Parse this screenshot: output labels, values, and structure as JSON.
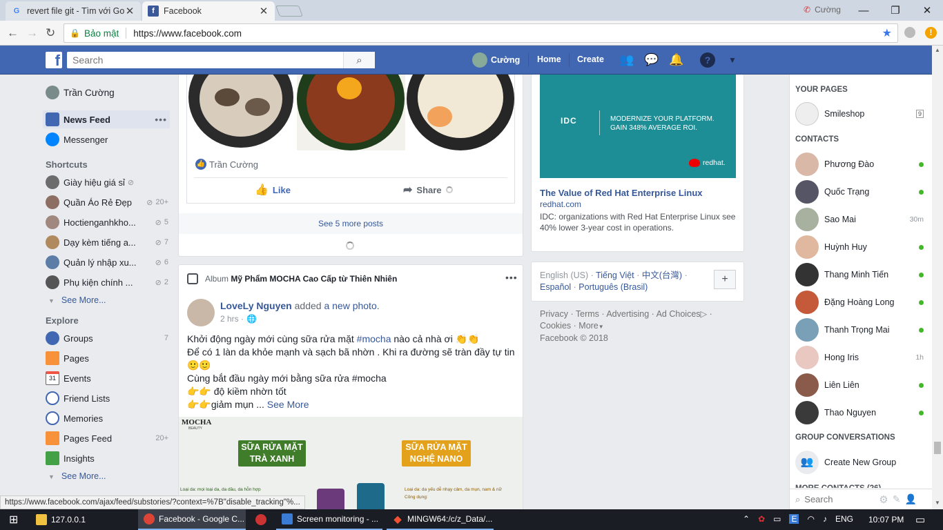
{
  "browser": {
    "tabs": [
      {
        "title": "revert file git - Tìm với Go"
      },
      {
        "title": "Facebook"
      }
    ],
    "user": "Cường",
    "secure_label": "Bảo mật",
    "url": "https://www.facebook.com"
  },
  "header": {
    "search_placeholder": "Search",
    "profile_name": "Cường",
    "home": "Home",
    "create": "Create"
  },
  "left_nav": {
    "profile": "Trần Cường",
    "news_feed": "News Feed",
    "messenger": "Messenger",
    "shortcuts_title": "Shortcuts",
    "shortcuts": [
      {
        "label": "Giày hiệu giá sỉ",
        "count": ""
      },
      {
        "label": "Quần Áo Rẻ Đẹp",
        "count": "20+"
      },
      {
        "label": "Hoctienganhkho...",
        "count": "5"
      },
      {
        "label": "Dạy kèm tiếng a...",
        "count": "7"
      },
      {
        "label": "Quản lý nhập xu...",
        "count": "6"
      },
      {
        "label": "Phụ kiện chính ...",
        "count": "2"
      }
    ],
    "see_more": "See More...",
    "explore_title": "Explore",
    "explore": [
      {
        "label": "Groups",
        "count": "7"
      },
      {
        "label": "Pages",
        "count": ""
      },
      {
        "label": "Events",
        "count": "",
        "icon_text": "31"
      },
      {
        "label": "Friend Lists",
        "count": ""
      },
      {
        "label": "Memories",
        "count": ""
      },
      {
        "label": "Pages Feed",
        "count": "20+"
      },
      {
        "label": "Insights",
        "count": ""
      }
    ],
    "see_more2": "See More..."
  },
  "feed": {
    "reaction_name": "Trần Cường",
    "like": "Like",
    "share": "Share",
    "see_more_posts": "See 5 more posts",
    "post": {
      "album_prefix": "Album",
      "album_name": "Mỹ Phẩm MOCHA Cao Cấp từ Thiên Nhiên",
      "author": "LoveLy Nguyen",
      "action_mid": "added",
      "action_link": "a new photo.",
      "time": "2 hrs ·",
      "line1_a": "Khởi động ngày mới cùng sữa rửa mặt",
      "line1_tag": "#mocha",
      "line1_b": "nào cả nhà ơi 👏👏",
      "line2": "Để có 1 làn da khỏe mạnh và sạch bã nhờn . Khi ra đường sẽ tràn đầy tự tin 🙂🙂",
      "line3": "Cùng bắt đầu ngày mới bằng sữa rửa #mocha",
      "line4": "👉👉 độ kiềm nhờn tốt",
      "line5": "👉👉giảm mụn ...",
      "see_more": "See More",
      "img_brand": "MOCHA",
      "img_brand_sub": "BEAUTY",
      "img_left": "SỮA RỬA MẶT\nTRÀ XANH",
      "img_right": "SỮA RỬA MẶT\nNGHỆ NANO",
      "img_note_left": "Loại da: mọi loại da, da dầu, da hỗn hợp",
      "img_note_right": "Loại da: da yếu dễ nhạy cảm, da mụn, nam & nữ",
      "img_note_right2": "Công dụng:"
    }
  },
  "ad": {
    "logo": "IDC",
    "banner_line1": "MODERNIZE YOUR PLATFORM.",
    "banner_line2": "GAIN 348% AVERAGE ROI.",
    "brand": "redhat.",
    "title": "The Value of Red Hat Enterprise Linux",
    "domain": "redhat.com",
    "desc": "IDC: organizations with Red Hat Enterprise Linux see 40% lower 3-year cost in operations."
  },
  "languages": {
    "current": "English (US)",
    "l1": "Tiếng Việt",
    "l2": "中文(台灣)",
    "l3": "Español",
    "l4": "Português (Brasil)"
  },
  "footer": {
    "privacy": "Privacy",
    "terms": "Terms",
    "advertising": "Advertising",
    "ad_choices": "Ad Choices",
    "cookies": "Cookies",
    "more": "More",
    "copyright": "Facebook © 2018"
  },
  "right": {
    "your_pages": "YOUR PAGES",
    "page_name": "Smileshop",
    "page_badge": "9",
    "contacts_title": "CONTACTS",
    "contacts": [
      {
        "name": "Phương Đào",
        "status": "online"
      },
      {
        "name": "Quốc Trạng",
        "status": "online"
      },
      {
        "name": "Sao Mai",
        "status": "30m"
      },
      {
        "name": "Huỳnh Huy",
        "status": "online"
      },
      {
        "name": "Thang Minh Tiến",
        "status": "online"
      },
      {
        "name": "Đặng Hoàng Long",
        "status": "online"
      },
      {
        "name": "Thanh Trọng Mai",
        "status": "online"
      },
      {
        "name": "Hong Iris",
        "status": "1h"
      },
      {
        "name": "Liên Liên",
        "status": "online"
      },
      {
        "name": "Thao Nguyen",
        "status": "online"
      }
    ],
    "group_conv": "GROUP CONVERSATIONS",
    "create_group": "Create New Group",
    "more_contacts": "MORE CONTACTS (26)",
    "search_placeholder": "Search"
  },
  "status_url": "https://www.facebook.com/ajax/feed/substories/?context=%7B\"disable_tracking\"%...",
  "taskbar": {
    "items": [
      "127.0.0.1",
      "Facebook - Google C...",
      "Screen monitoring - ...",
      "MINGW64:/c/z_Data/..."
    ],
    "lang": "ENG",
    "time": "10:07 PM"
  }
}
